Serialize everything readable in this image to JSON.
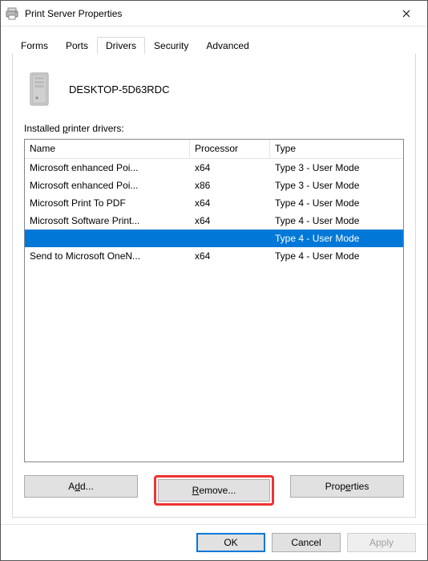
{
  "window": {
    "title": "Print Server Properties",
    "close_icon": "close-icon"
  },
  "tabs": {
    "items": [
      {
        "label": "Forms",
        "active": false
      },
      {
        "label": "Ports",
        "active": false
      },
      {
        "label": "Drivers",
        "active": true
      },
      {
        "label": "Security",
        "active": false
      },
      {
        "label": "Advanced",
        "active": false
      }
    ]
  },
  "server": {
    "name": "DESKTOP-5D63RDC"
  },
  "drivers": {
    "section_label_pre": "Installed ",
    "section_label_ul": "p",
    "section_label_post": "rinter drivers:",
    "columns": {
      "name": "Name",
      "processor": "Processor",
      "type": "Type"
    },
    "rows": [
      {
        "name": "Microsoft enhanced Poi...",
        "processor": "x64",
        "type": "Type 3 - User Mode",
        "selected": false
      },
      {
        "name": "Microsoft enhanced Poi...",
        "processor": "x86",
        "type": "Type 3 - User Mode",
        "selected": false
      },
      {
        "name": "Microsoft Print To PDF",
        "processor": "x64",
        "type": "Type 4 - User Mode",
        "selected": false
      },
      {
        "name": "Microsoft Software Print...",
        "processor": "x64",
        "type": "Type 4 - User Mode",
        "selected": false
      },
      {
        "name": "",
        "processor": "",
        "type": "Type 4 - User Mode",
        "selected": true
      },
      {
        "name": "Send to Microsoft OneN...",
        "processor": "x64",
        "type": "Type 4 - User Mode",
        "selected": false
      }
    ]
  },
  "actions": {
    "add_pre": "A",
    "add_ul": "d",
    "add_post": "d...",
    "remove_pre": "",
    "remove_ul": "R",
    "remove_post": "emove...",
    "props_pre": "Prop",
    "props_ul": "e",
    "props_post": "rties"
  },
  "dialog_buttons": {
    "ok": "OK",
    "cancel": "Cancel",
    "apply_ul": "A",
    "apply_post": "pply"
  }
}
